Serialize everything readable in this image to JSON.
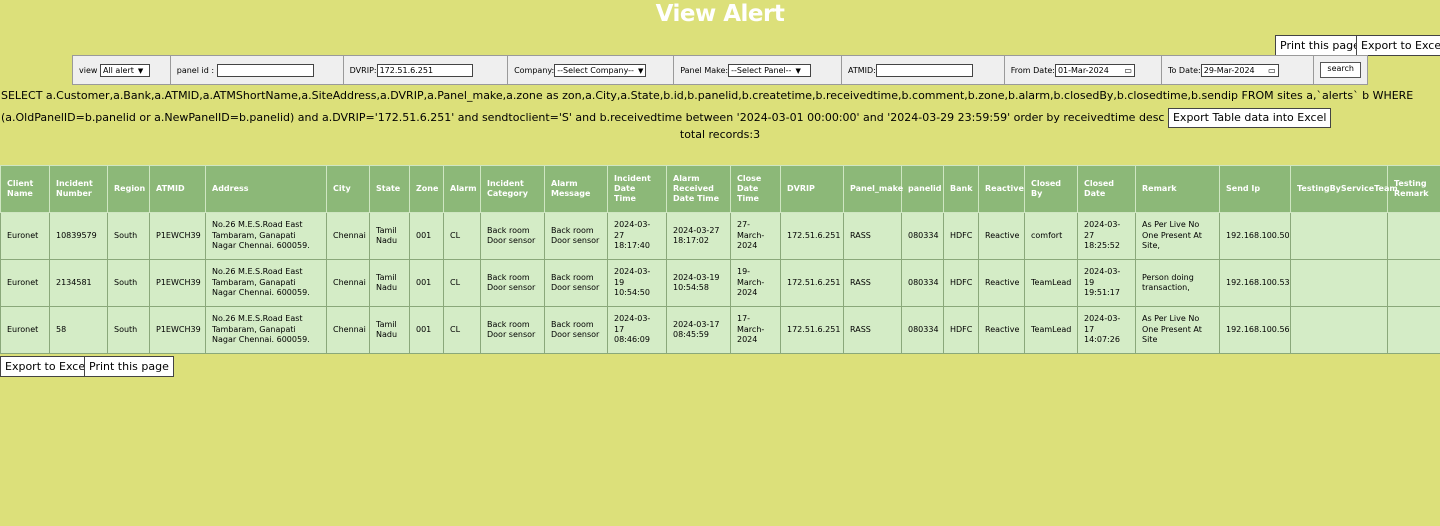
{
  "page": {
    "title": "View Alert"
  },
  "toolbar_top": {
    "print_label": "Print this page",
    "export_label": "Export to Excel"
  },
  "filters": {
    "view_label": "view",
    "view_value": "All alert",
    "panel_id_label": "panel id :",
    "panel_id_value": "",
    "dvrip_label": "DVRIP:",
    "dvrip_value": "172.51.6.251",
    "company_label": "Company:",
    "company_value": "--Select Company--",
    "panel_make_label": "Panel Make:",
    "panel_make_value": "--Select Panel--",
    "atmid_label": "ATMID:",
    "atmid_value": "",
    "from_date_label": "From Date:",
    "from_date_value": "01-Mar-2024",
    "to_date_label": "To Date:",
    "to_date_value": "29-Mar-2024",
    "search_label": "search"
  },
  "query": {
    "sql_text": "SELECT a.Customer,a.Bank,a.ATMID,a.ATMShortName,a.SiteAddress,a.DVRIP,a.Panel_make,a.zone as zon,a.City,a.State,b.id,b.panelid,b.createtime,b.receivedtime,b.comment,b.zone,b.alarm,b.closedBy,b.closedtime,b.sendip FROM sites a,`alerts` b WHERE (a.OldPanelID=b.panelid or a.NewPanelID=b.panelid) and a.DVRIP='172.51.6.251' and sendtoclient='S' and b.receivedtime between '2024-03-01 00:00:00' and '2024-03-29 23:59:59' order by receivedtime desc",
    "export_table_label": "Export Table data into Excel"
  },
  "summary": {
    "total_records": "total records:3"
  },
  "table": {
    "headers": [
      "Client Name",
      "Incident Number",
      "Region",
      "ATMID",
      "Address",
      "City",
      "State",
      "Zone",
      "Alarm",
      "Incident Category",
      "Alarm Message",
      "Incident Date Time",
      "Alarm Received Date Time",
      "Close Date Time",
      "DVRIP",
      "Panel_make",
      "panelid",
      "Bank",
      "Reactive",
      "Closed By",
      "Closed Date",
      "Remark",
      "Send Ip",
      "TestingByServiceTeam",
      "Testing Remark"
    ],
    "rows": [
      [
        "Euronet",
        "10839579",
        "South",
        "P1EWCH39",
        "No.26 M.E.S.Road East Tambaram, Ganapati Nagar Chennai. 600059.",
        "Chennai",
        "Tamil Nadu",
        "001",
        "CL",
        "Back room Door sensor",
        "Back room Door sensor",
        "2024-03-27 18:17:40",
        "2024-03-27 18:17:02",
        "27-March-2024",
        "172.51.6.251",
        "RASS",
        "080334",
        "HDFC",
        "Reactive",
        "comfort",
        "2024-03-27 18:25:52",
        "As Per Live No One Present At Site,",
        "192.168.100.50",
        "",
        ""
      ],
      [
        "Euronet",
        "2134581",
        "South",
        "P1EWCH39",
        "No.26 M.E.S.Road East Tambaram, Ganapati Nagar Chennai. 600059.",
        "Chennai",
        "Tamil Nadu",
        "001",
        "CL",
        "Back room Door sensor",
        "Back room Door sensor",
        "2024-03-19 10:54:50",
        "2024-03-19 10:54:58",
        "19-March-2024",
        "172.51.6.251",
        "RASS",
        "080334",
        "HDFC",
        "Reactive",
        "TeamLead",
        "2024-03-19 19:51:17",
        "Person doing transaction,",
        "192.168.100.53",
        "",
        ""
      ],
      [
        "Euronet",
        "58",
        "South",
        "P1EWCH39",
        "No.26 M.E.S.Road East Tambaram, Ganapati Nagar Chennai. 600059.",
        "Chennai",
        "Tamil Nadu",
        "001",
        "CL",
        "Back room Door sensor",
        "Back room Door sensor",
        "2024-03-17 08:46:09",
        "2024-03-17 08:45:59",
        "17-March-2024",
        "172.51.6.251",
        "RASS",
        "080334",
        "HDFC",
        "Reactive",
        "TeamLead",
        "2024-03-17 14:07:26",
        "As Per Live No One Present At Site",
        "192.168.100.56",
        "",
        ""
      ]
    ]
  },
  "toolbar_bottom": {
    "export_label": "Export to Excel",
    "print_label": "Print this page"
  }
}
